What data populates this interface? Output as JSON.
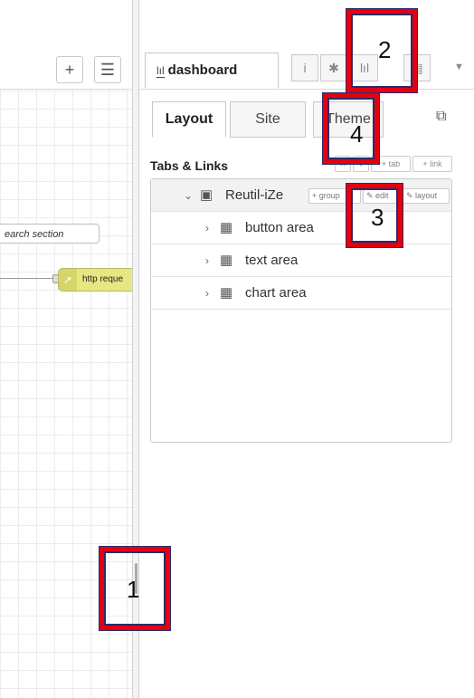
{
  "canvas": {
    "add_icon": "+",
    "list_icon": "☰",
    "comment_node": "earch section",
    "http_node": "http reque"
  },
  "sidebar": {
    "active_tab": "dashboard",
    "tab_icons": [
      "info-icon",
      "debug-icon",
      "dashboard-icon",
      "other-icon"
    ],
    "subtabs": [
      "Layout",
      "Site",
      "Theme"
    ],
    "section_title": "Tabs & Links",
    "section_buttons": [
      "✕",
      "▾",
      "+ tab",
      "+ link"
    ],
    "tree": {
      "tab": {
        "label": "Reutil-iZe",
        "buttons": [
          "+ group",
          "edit",
          "layout"
        ]
      },
      "groups": [
        "button area",
        "text area",
        "chart area"
      ]
    }
  },
  "annotations": [
    "1",
    "2",
    "3",
    "4"
  ]
}
